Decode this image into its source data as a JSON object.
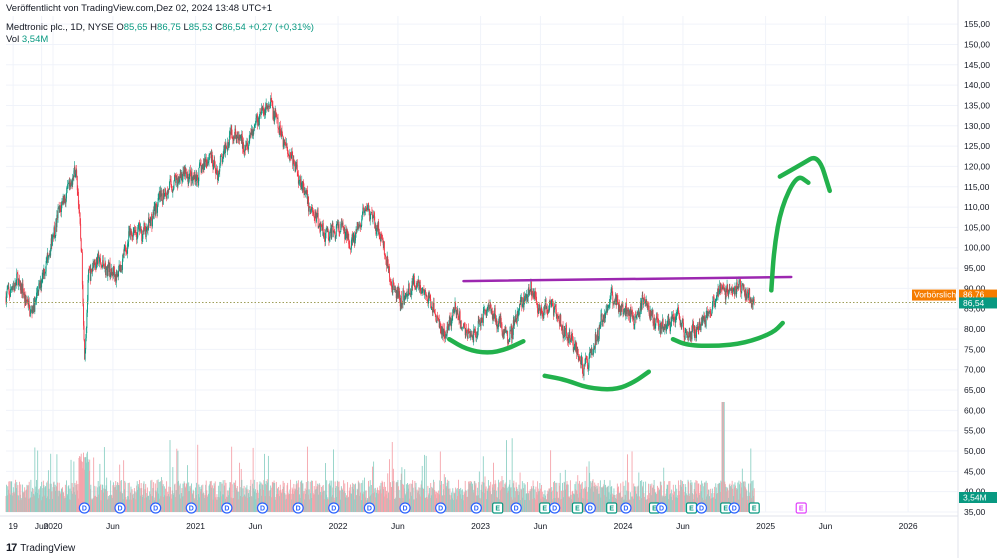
{
  "header": {
    "published": "Veröffentlicht von TradingView.com,Dez 02, 2024 13:48 UTC+1",
    "symbol": "Medtronic plc., 1D, NYSE",
    "open_label": "O",
    "open": "85,65",
    "high_label": "H",
    "high": "86,75",
    "low_label": "L",
    "low": "85,53",
    "close_label": "C",
    "close": "86,54",
    "change": "+0,27 (+0,31%)",
    "volume_label": "Vol",
    "volume": "3,54M"
  },
  "footer": {
    "brand": "TradingView",
    "logo_glyph": "17"
  },
  "price_tags": {
    "premarket_label": "Vorbörslich",
    "premarket_value": "86,76",
    "last_value": "86,54",
    "volume_value": "3,54M"
  },
  "colors": {
    "up": "#089981",
    "down": "#f23645",
    "up_vol": "#8fd1c6",
    "down_vol": "#f5a4ab",
    "resistance": "#9c27b0",
    "drawing": "#22b14c",
    "premarket": "#f57c00",
    "grid": "#f0f3fa",
    "dotted": "#9e9e5a"
  },
  "chart_data": {
    "type": "candlestick",
    "title": "Medtronic plc., 1D, NYSE",
    "y_axis": {
      "ylim": [
        35,
        157
      ],
      "ticks": [
        "155,00",
        "150,00",
        "145,00",
        "140,00",
        "135,00",
        "130,00",
        "125,00",
        "120,00",
        "115,00",
        "110,00",
        "105,00",
        "100,00",
        "95,00",
        "90,00",
        "85,00",
        "80,00",
        "75,00",
        "70,00",
        "65,00",
        "60,00",
        "55,00",
        "50,00",
        "45,00",
        "40,00",
        "35,00"
      ],
      "tick_values": [
        155,
        150,
        145,
        140,
        135,
        130,
        125,
        120,
        115,
        110,
        105,
        100,
        95,
        90,
        85,
        80,
        75,
        70,
        65,
        60,
        55,
        50,
        45,
        40,
        35
      ]
    },
    "x_axis": {
      "range": [
        2019.67,
        2026.35
      ],
      "ticks": [
        {
          "label": "19",
          "t": 2019.72
        },
        {
          "label": "Jun",
          "t": 2019.92
        },
        {
          "label": "2020",
          "t": 2020.0
        },
        {
          "label": "Jun",
          "t": 2020.42
        },
        {
          "label": "2021",
          "t": 2021.0
        },
        {
          "label": "Jun",
          "t": 2021.42
        },
        {
          "label": "2022",
          "t": 2022.0
        },
        {
          "label": "Jun",
          "t": 2022.42
        },
        {
          "label": "2023",
          "t": 2023.0
        },
        {
          "label": "Jun",
          "t": 2023.42
        },
        {
          "label": "2024",
          "t": 2024.0
        },
        {
          "label": "Jun",
          "t": 2024.42
        },
        {
          "label": "2025",
          "t": 2025.0
        },
        {
          "label": "Jun",
          "t": 2025.42
        },
        {
          "label": "2026",
          "t": 2026.0
        }
      ]
    },
    "price_path": [
      [
        2019.67,
        88
      ],
      [
        2019.75,
        92
      ],
      [
        2019.85,
        84
      ],
      [
        2019.95,
        96
      ],
      [
        2020.05,
        110
      ],
      [
        2020.12,
        115
      ],
      [
        2020.16,
        120
      ],
      [
        2020.2,
        100
      ],
      [
        2020.22,
        73
      ],
      [
        2020.25,
        93
      ],
      [
        2020.3,
        97
      ],
      [
        2020.45,
        93
      ],
      [
        2020.55,
        104
      ],
      [
        2020.65,
        104
      ],
      [
        2020.75,
        112
      ],
      [
        2020.9,
        118
      ],
      [
        2021.0,
        117
      ],
      [
        2021.1,
        123
      ],
      [
        2021.15,
        118
      ],
      [
        2021.25,
        129
      ],
      [
        2021.35,
        125
      ],
      [
        2021.45,
        133
      ],
      [
        2021.53,
        135
      ],
      [
        2021.6,
        128
      ],
      [
        2021.7,
        120
      ],
      [
        2021.8,
        110
      ],
      [
        2021.92,
        103
      ],
      [
        2022.02,
        105
      ],
      [
        2022.1,
        101
      ],
      [
        2022.2,
        110
      ],
      [
        2022.3,
        103
      ],
      [
        2022.38,
        90
      ],
      [
        2022.45,
        87
      ],
      [
        2022.55,
        92
      ],
      [
        2022.65,
        86
      ],
      [
        2022.75,
        78
      ],
      [
        2022.82,
        85
      ],
      [
        2022.88,
        80
      ],
      [
        2022.95,
        78
      ],
      [
        2023.05,
        86
      ],
      [
        2023.12,
        82
      ],
      [
        2023.2,
        78
      ],
      [
        2023.28,
        86
      ],
      [
        2023.35,
        90
      ],
      [
        2023.42,
        84
      ],
      [
        2023.5,
        86
      ],
      [
        2023.58,
        80
      ],
      [
        2023.66,
        76
      ],
      [
        2023.72,
        70
      ],
      [
        2023.78,
        74
      ],
      [
        2023.85,
        82
      ],
      [
        2023.92,
        88
      ],
      [
        2024.0,
        85
      ],
      [
        2024.08,
        83
      ],
      [
        2024.15,
        87
      ],
      [
        2024.22,
        82
      ],
      [
        2024.3,
        80
      ],
      [
        2024.38,
        84
      ],
      [
        2024.45,
        78
      ],
      [
        2024.52,
        80
      ],
      [
        2024.6,
        84
      ],
      [
        2024.68,
        90
      ],
      [
        2024.75,
        89
      ],
      [
        2024.82,
        91
      ],
      [
        2024.88,
        88
      ],
      [
        2024.92,
        86.54
      ]
    ],
    "volume_max": 75
  },
  "annotations": {
    "resistance": {
      "t0": 2022.88,
      "t1": 2025.18,
      "p0": 91.8,
      "p1": 92.8
    },
    "arcs": [
      [
        [
          2022.78,
          77.5
        ],
        [
          2022.9,
          75
        ],
        [
          2023.05,
          74
        ],
        [
          2023.18,
          75
        ],
        [
          2023.3,
          77
        ]
      ],
      [
        [
          2023.45,
          68.5
        ],
        [
          2023.6,
          67.5
        ],
        [
          2023.75,
          65.5
        ],
        [
          2023.95,
          65
        ],
        [
          2024.08,
          67
        ],
        [
          2024.18,
          69.5
        ]
      ],
      [
        [
          2024.35,
          77.5
        ],
        [
          2024.45,
          76
        ],
        [
          2024.65,
          75.8
        ],
        [
          2024.85,
          76.5
        ],
        [
          2025.05,
          79
        ],
        [
          2025.12,
          81.5
        ]
      ],
      [
        [
          2025.04,
          89.5
        ],
        [
          2025.06,
          100
        ],
        [
          2025.11,
          110
        ],
        [
          2025.22,
          118
        ],
        [
          2025.3,
          116
        ]
      ],
      [
        [
          2025.1,
          117.5
        ],
        [
          2025.25,
          120.5
        ],
        [
          2025.37,
          123
        ],
        [
          2025.45,
          114
        ]
      ]
    ],
    "events": [
      {
        "t": 2020.22,
        "type": "D"
      },
      {
        "t": 2020.47,
        "type": "D"
      },
      {
        "t": 2020.72,
        "type": "D"
      },
      {
        "t": 2020.97,
        "type": "D"
      },
      {
        "t": 2021.22,
        "type": "D"
      },
      {
        "t": 2021.47,
        "type": "D"
      },
      {
        "t": 2021.72,
        "type": "D"
      },
      {
        "t": 2021.97,
        "type": "D"
      },
      {
        "t": 2022.22,
        "type": "D"
      },
      {
        "t": 2022.47,
        "type": "D"
      },
      {
        "t": 2022.72,
        "type": "D"
      },
      {
        "t": 2022.97,
        "type": "D"
      },
      {
        "t": 2023.12,
        "type": "E"
      },
      {
        "t": 2023.25,
        "type": "D"
      },
      {
        "t": 2023.45,
        "type": "E"
      },
      {
        "t": 2023.52,
        "type": "D"
      },
      {
        "t": 2023.68,
        "type": "E"
      },
      {
        "t": 2023.77,
        "type": "D"
      },
      {
        "t": 2023.92,
        "type": "E"
      },
      {
        "t": 2024.02,
        "type": "D"
      },
      {
        "t": 2024.22,
        "type": "E"
      },
      {
        "t": 2024.27,
        "type": "D"
      },
      {
        "t": 2024.48,
        "type": "E"
      },
      {
        "t": 2024.55,
        "type": "D"
      },
      {
        "t": 2024.72,
        "type": "E"
      },
      {
        "t": 2024.78,
        "type": "D"
      },
      {
        "t": 2024.92,
        "type": "E"
      },
      {
        "t": 2025.25,
        "type": "E",
        "future": true
      }
    ]
  }
}
